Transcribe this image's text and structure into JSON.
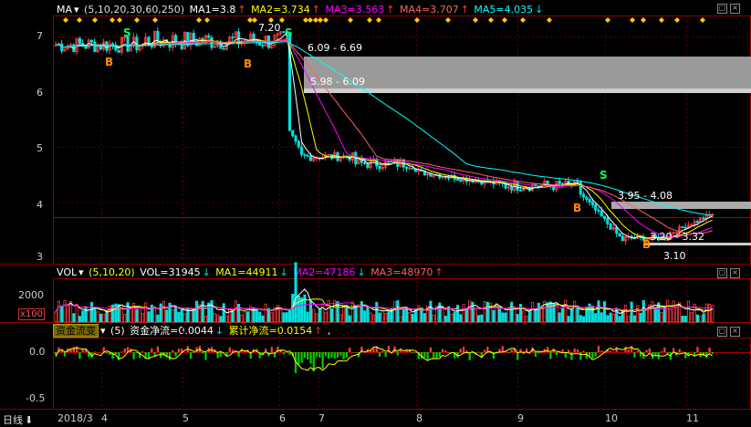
{
  "main": {
    "indicator": "MA",
    "params": "(5,10,20,30,60,250)",
    "ma1": "MA1=3.8",
    "ma1_arrow": "↑",
    "ma2": "MA2=3.734",
    "ma2_arrow": "↑",
    "ma3": "MA3=3.563",
    "ma3_arrow": "↑",
    "ma4": "MA4=3.707",
    "ma4_arrow": "↑",
    "ma5": "MA5=4.035",
    "ma5_arrow": "↓",
    "y_ticks": [
      "7",
      "6",
      "5",
      "4",
      "3"
    ],
    "annotations": {
      "high": "7.20",
      "zone1": "6.09 - 6.69",
      "zone2": "5.98 - 6.09",
      "zone3": "3.95 - 4.08",
      "zone4": "3.20 - 3.32",
      "low": "3.10"
    },
    "signal_buy": "B",
    "signal_sell": "S"
  },
  "volume": {
    "indicator": "VOL",
    "params": "(5,10,20)",
    "vol": "VOL=31945",
    "vol_arrow": "↓",
    "ma1": "MA1=44911",
    "ma1_arrow": "↓",
    "ma2": "MA2=47186",
    "ma2_arrow": "↓",
    "ma3": "MA3=48970",
    "ma3_arrow": "↑",
    "y_tick": "2000",
    "unit": "x100"
  },
  "flow": {
    "indicator": "资金流变",
    "params": "(5)",
    "net": "资金净流=0.0044",
    "net_arrow": "↓",
    "cum": "累计净流=0.0154",
    "cum_arrow": "↑",
    "trail": ",",
    "y_ticks": [
      "0.0",
      "-0.5"
    ]
  },
  "x_axis": {
    "period_button": "日线",
    "labels": [
      "2018/3",
      "4",
      "5",
      "6",
      "7",
      "8",
      "9",
      "10",
      "11"
    ]
  },
  "colors": {
    "up": "#ff3c3c",
    "down": "#00e0e0",
    "ma1": "#ffffff",
    "ma2": "#ffff00",
    "ma3": "#ff00ff",
    "ma4": "#ff6060",
    "ma5": "#00ffff"
  }
}
